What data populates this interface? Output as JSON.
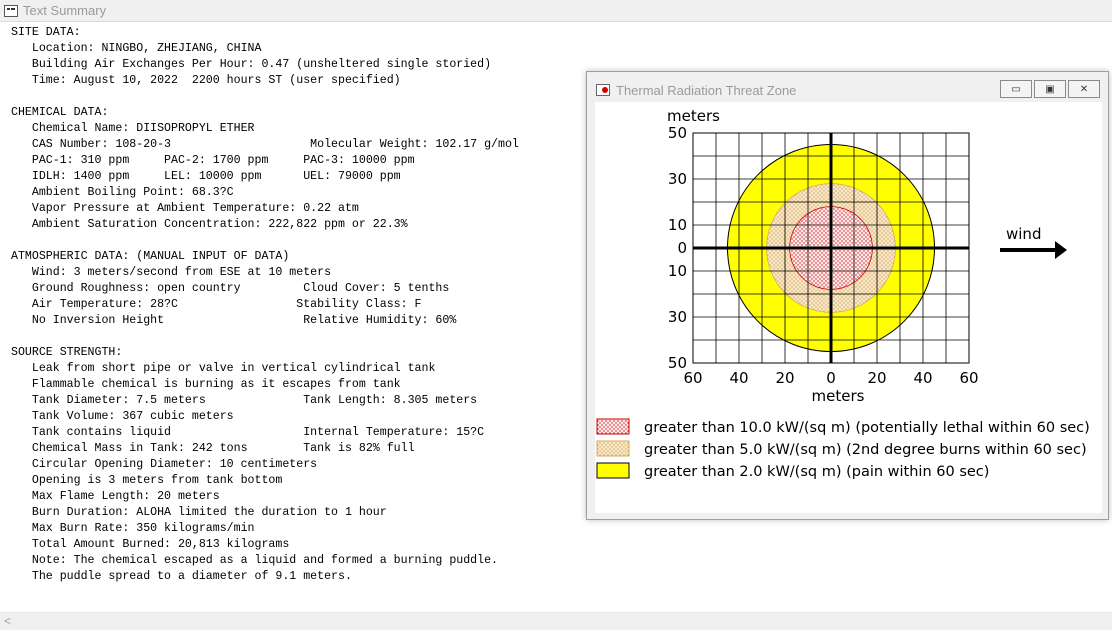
{
  "main_window": {
    "title": "Text Summary"
  },
  "summary_lines": [
    "SITE DATA:",
    "   Location: NINGBO, ZHEJIANG, CHINA",
    "   Building Air Exchanges Per Hour: 0.47 (unsheltered single storied)",
    "   Time: August 10, 2022  2200 hours ST (user specified)",
    "",
    "CHEMICAL DATA:",
    "   Chemical Name: DIISOPROPYL ETHER",
    "   CAS Number: 108-20-3                    Molecular Weight: 102.17 g/mol",
    "   PAC-1: 310 ppm     PAC-2: 1700 ppm     PAC-3: 10000 ppm",
    "   IDLH: 1400 ppm     LEL: 10000 ppm      UEL: 79000 ppm",
    "   Ambient Boiling Point: 68.3?C",
    "   Vapor Pressure at Ambient Temperature: 0.22 atm",
    "   Ambient Saturation Concentration: 222,822 ppm or 22.3%",
    "",
    "ATMOSPHERIC DATA: (MANUAL INPUT OF DATA)",
    "   Wind: 3 meters/second from ESE at 10 meters",
    "   Ground Roughness: open country         Cloud Cover: 5 tenths",
    "   Air Temperature: 28?C                 Stability Class: F",
    "   No Inversion Height                    Relative Humidity: 60%",
    "",
    "SOURCE STRENGTH:",
    "   Leak from short pipe or valve in vertical cylindrical tank",
    "   Flammable chemical is burning as it escapes from tank",
    "   Tank Diameter: 7.5 meters              Tank Length: 8.305 meters",
    "   Tank Volume: 367 cubic meters",
    "   Tank contains liquid                   Internal Temperature: 15?C",
    "   Chemical Mass in Tank: 242 tons        Tank is 82% full",
    "   Circular Opening Diameter: 10 centimeters",
    "   Opening is 3 meters from tank bottom",
    "   Max Flame Length: 20 meters",
    "   Burn Duration: ALOHA limited the duration to 1 hour",
    "   Max Burn Rate: 350 kilograms/min",
    "   Total Amount Burned: 20,813 kilograms",
    "   Note: The chemical escaped as a liquid and formed a burning puddle.",
    "   The puddle spread to a diameter of 9.1 meters."
  ],
  "scrollbar": {
    "left_arrow": "<"
  },
  "thermal_window": {
    "title": "Thermal Radiation Threat Zone",
    "buttons": {
      "minimize": "▭",
      "restore": "▣",
      "close": "✕"
    }
  },
  "colors": {
    "red_zone_fill": "#fbe9e9",
    "red_zone_dots": "#d01010",
    "orange_zone_fill": "#f8e7c4",
    "orange_zone_dots": "#c0883a",
    "yellow_zone": "#ffff00"
  },
  "chart_data": {
    "type": "threat_zone_map",
    "xlabel": "meters",
    "ylabel": "meters",
    "xlim": [
      -60,
      60
    ],
    "ylim": [
      -50,
      50
    ],
    "x_ticks": [
      -60,
      -40,
      -20,
      0,
      20,
      40,
      60
    ],
    "x_tick_labels": [
      "60",
      "40",
      "20",
      "0",
      "20",
      "40",
      "60"
    ],
    "y_ticks": [
      50,
      30,
      10,
      0,
      -10,
      -30,
      -50
    ],
    "y_tick_labels": [
      "50",
      "30",
      "10",
      "0",
      "10",
      "30",
      "50"
    ],
    "grid": true,
    "zones": [
      {
        "label": "greater than 2.0 kW/(sq m) (pain within 60 sec)",
        "radius_m": 45,
        "color": "#ffff00",
        "pattern": "solid"
      },
      {
        "label": "greater than 5.0 kW/(sq m) (2nd degree burns within 60 sec)",
        "radius_m": 28,
        "color": "#f8e7c4",
        "pattern": "orange-dots"
      },
      {
        "label": "greater than 10.0 kW/(sq m) (potentially lethal within 60 sec)",
        "radius_m": 18,
        "color": "#fbe9e9",
        "pattern": "red-dots"
      }
    ],
    "legend_order": [
      2,
      1,
      0
    ],
    "wind_label": "wind"
  }
}
